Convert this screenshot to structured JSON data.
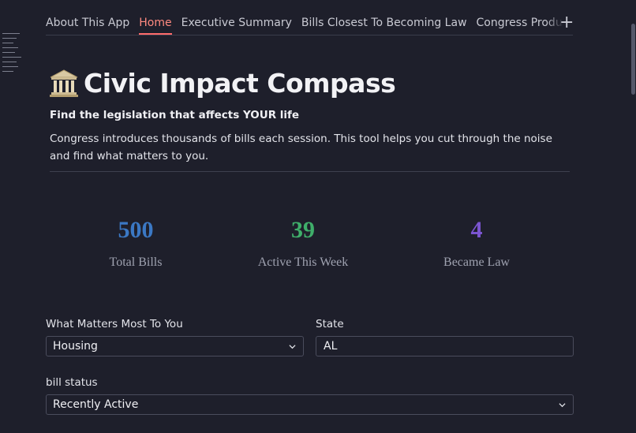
{
  "tabs": [
    {
      "label": "About This App",
      "active": false
    },
    {
      "label": "Home",
      "active": true
    },
    {
      "label": "Executive Summary",
      "active": false
    },
    {
      "label": "Bills Closest To Becoming Law",
      "active": false
    },
    {
      "label": "Congress Productivity Report",
      "active": false
    }
  ],
  "add_tab_icon": "plus-icon",
  "header": {
    "title": "Civic Impact Compass",
    "title_icon": "classical-building-icon",
    "subtitle": "Find the legislation that affects YOUR life",
    "description": "Congress introduces thousands of bills each session. This tool helps you cut through the noise and find what matters to you."
  },
  "metrics": [
    {
      "value": "500",
      "label": "Total Bills",
      "color": "#3b78c4"
    },
    {
      "value": "39",
      "label": "Active This Week",
      "color": "#3fae6a"
    },
    {
      "value": "4",
      "label": "Became Law",
      "color": "#7b55d1"
    }
  ],
  "filters": {
    "interest": {
      "label": "What Matters Most To You",
      "value": "Housing"
    },
    "state": {
      "label": "State",
      "value": "AL"
    },
    "status": {
      "label": "bill status",
      "value": "Recently Active"
    }
  },
  "colors": {
    "background": "#1e1f2b",
    "accent": "#ff6b6b",
    "border": "#4a4c5c"
  }
}
